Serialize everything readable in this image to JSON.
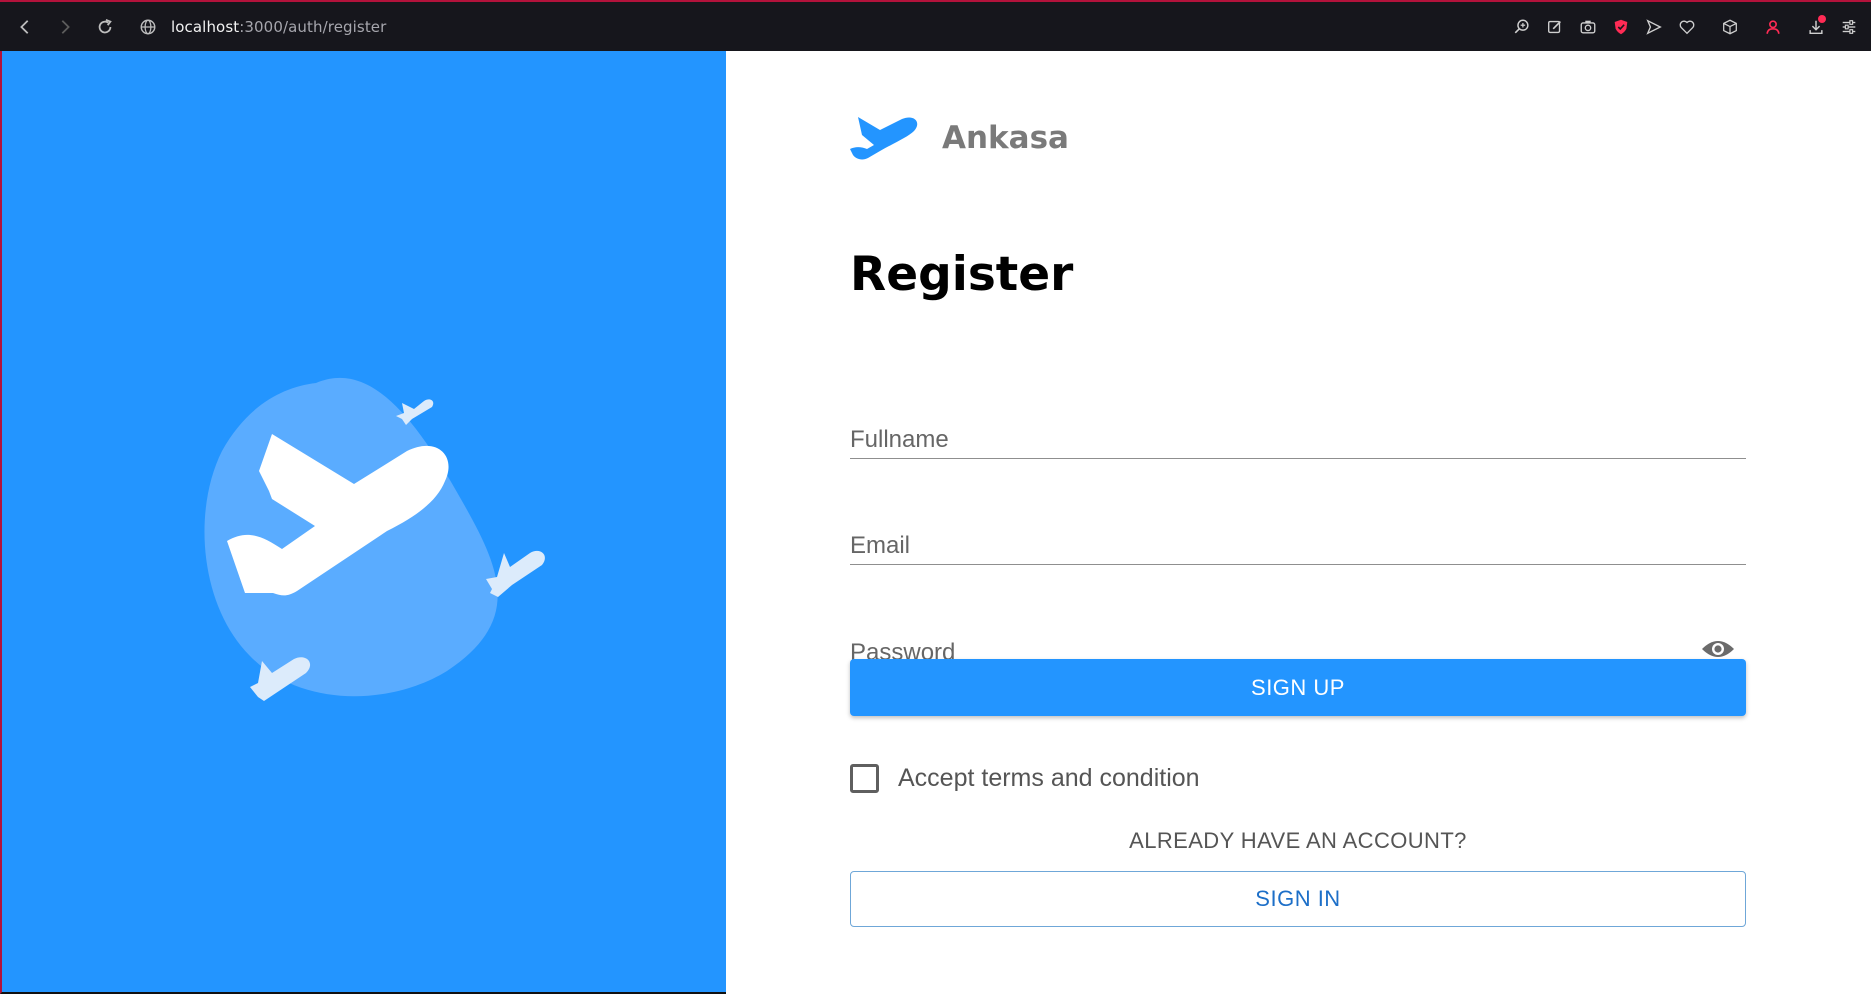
{
  "browser": {
    "url_host": "localhost",
    "url_path": ":3000/auth/register",
    "icons": [
      "back-icon",
      "forward-icon",
      "reload-icon",
      "site-info-icon",
      "zoom-icon",
      "edit-icon",
      "camera-icon",
      "shield-icon",
      "send-icon",
      "heart-icon",
      "cube-icon",
      "profile-icon",
      "download-icon",
      "sliders-icon"
    ]
  },
  "brand": {
    "name": "Ankasa",
    "primary_color": "#2395ff"
  },
  "form": {
    "title": "Register",
    "fullname_placeholder": "Fullname",
    "email_placeholder": "Email",
    "password_placeholder": "Password",
    "signup_label": "SIGN UP",
    "terms_label": "Accept terms and condition",
    "terms_checked": false,
    "have_account_text": "ALREADY HAVE AN ACCOUNT?",
    "signin_label": "SIGN IN"
  }
}
